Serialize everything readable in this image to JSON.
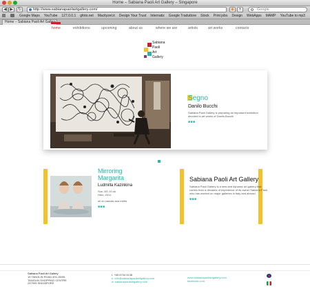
{
  "browser": {
    "window_title": "Home – Sabiana Paoli Art Gallery – Singapore",
    "url": "http://www.sabianapaoliartgallery.com/",
    "search_placeholder": "Google",
    "bookmarks": [
      "Google Maps",
      "YouTube",
      "127.0.0.1",
      "gfoto.net",
      "Macityzet.it",
      "Design Your Trust",
      "Internatiz",
      "Google Traduttore",
      "Stock",
      "Print jobs",
      "Design",
      "WebApps",
      "MAMP",
      "YouTube to mp3"
    ],
    "tab_label": "Home – Sabiana Paoli Art Gallery"
  },
  "nav": {
    "items": [
      "home",
      "exhibitions",
      "upcoming",
      "about us",
      "where we are",
      "artists",
      "art works",
      "contacts"
    ]
  },
  "logo": {
    "lines": [
      "Sabiana",
      "Paoli",
      "Art",
      "Gallery"
    ],
    "colors": [
      "#c0252b",
      "#f1c22b",
      "#2cb4a8",
      "#7a3d8f"
    ]
  },
  "feature": {
    "title_first": "S",
    "title_rest": "egno",
    "artist": "Danilo Bucchi",
    "description": "Sabiana Paoli Gallery is preparing an important exhibition devoted to art works of Danilo Bucchi",
    "dots": "■■■"
  },
  "exhibition": {
    "title_first": "M",
    "title_rest_line1": "irroring",
    "title_line2": "Margarita",
    "artist": "Ludmilla Kazinkina",
    "date_line1": "Sun, 8/1-10 ok",
    "date_line2": "Hem, 2011",
    "medium": "oil on canvas and metrs",
    "dots": "■■■"
  },
  "about": {
    "title_first": "S",
    "title_rest": "abiana Paoli Art Gallery",
    "description": "Sabiana Paoli Gallery is a new and dynamic art gallery that comes from a decades of experience of its owner Sabiana Paoli, who has worked on major galleries in Italy and abroad",
    "dots": "■■■"
  },
  "footer": {
    "address": [
      "Sabiana Paoli Art Gallery",
      "15 TANGLIN ROAD #01-05/06",
      "TANGLIN SHOPPING CENTRE",
      "247909 SINGAPORE"
    ],
    "contacts": [
      "t. +65 6734 5138",
      "e. info@sabianapaoliartgallery.com",
      "w. sabianapaoliartgallery.com"
    ],
    "social": [
      "www.sabianapaoliartgallery.com",
      "facebook.com"
    ]
  },
  "colors": {
    "accent_teal": "#2cb4a8",
    "accent_yellow": "#f1c22b",
    "accent_red": "#c0252b"
  }
}
